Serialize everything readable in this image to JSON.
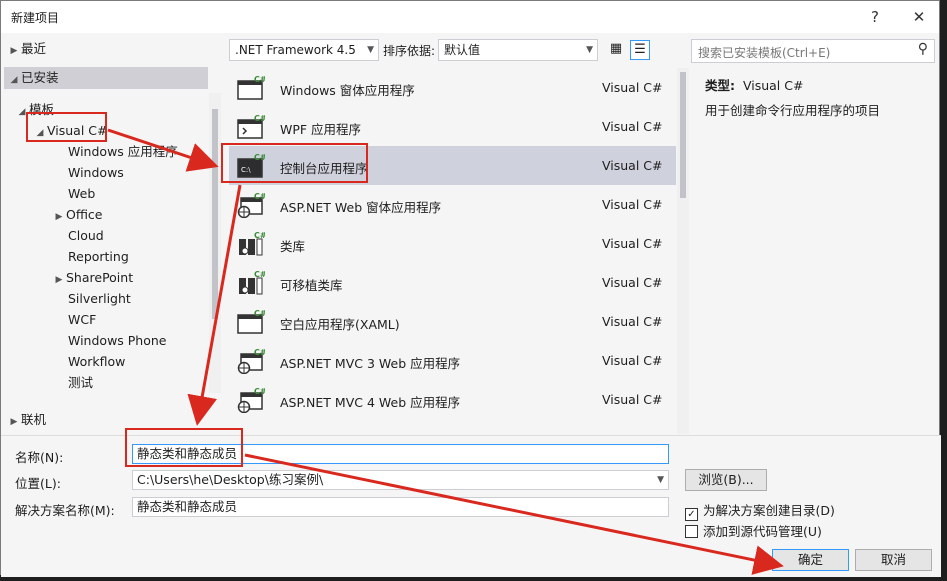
{
  "window": {
    "title": "新建项目",
    "help_label": "?",
    "close_label": "✕"
  },
  "tree": {
    "recent": "最近",
    "installed": "已安装",
    "templates": "模板",
    "visual_csharp": "Visual C#",
    "children": [
      "Windows 应用程序",
      "Windows",
      "Web",
      "Office",
      "Cloud",
      "Reporting",
      "SharePoint",
      "Silverlight",
      "WCF",
      "Windows Phone",
      "Workflow",
      "测试"
    ],
    "online": "联机"
  },
  "toolbar": {
    "framework": ".NET Framework 4.5",
    "sort_label": "排序依据:",
    "sort_value": "默认值"
  },
  "templates": [
    {
      "name": "Windows 窗体应用程序",
      "lang": "Visual C#",
      "icon": "window-icon"
    },
    {
      "name": "WPF 应用程序",
      "lang": "Visual C#",
      "icon": "wpf-icon"
    },
    {
      "name": "控制台应用程序",
      "lang": "Visual C#",
      "icon": "console-icon"
    },
    {
      "name": "ASP.NET Web 窗体应用程序",
      "lang": "Visual C#",
      "icon": "globe-window-icon"
    },
    {
      "name": "类库",
      "lang": "Visual C#",
      "icon": "library-icon"
    },
    {
      "name": "可移植类库",
      "lang": "Visual C#",
      "icon": "library-icon"
    },
    {
      "name": "空白应用程序(XAML)",
      "lang": "Visual C#",
      "icon": "window-icon"
    },
    {
      "name": "ASP.NET MVC 3 Web 应用程序",
      "lang": "Visual C#",
      "icon": "globe-window-icon"
    },
    {
      "name": "ASP.NET MVC 4 Web 应用程序",
      "lang": "Visual C#",
      "icon": "globe-window-icon"
    }
  ],
  "search": {
    "placeholder": "搜索已安装模板(Ctrl+E)"
  },
  "description": {
    "type_label": "类型:",
    "type_value": "Visual C#",
    "text": "用于创建命令行应用程序的项目"
  },
  "form": {
    "name_label": "名称(N):",
    "name_value": "静态类和静态成员",
    "location_label": "位置(L):",
    "location_value": "C:\\Users\\he\\Desktop\\练习案例\\",
    "solution_label": "解决方案名称(M):",
    "solution_value": "静态类和静态成员",
    "browse_label": "浏览(B)...",
    "create_dir_label": "为解决方案创建目录(D)",
    "add_scc_label": "添加到源代码管理(U)",
    "ok_label": "确定",
    "cancel_label": "取消"
  },
  "colors": {
    "accent": "#3399ff",
    "annotation": "#d9281e",
    "selected": "#cfd1dc"
  }
}
